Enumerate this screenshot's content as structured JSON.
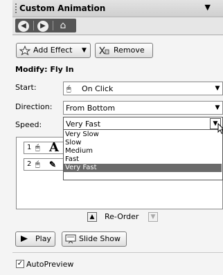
{
  "header": {
    "title": "Custom Animation",
    "menu_glyph": "▼",
    "nav": {
      "back_icon": "back-arrow-icon",
      "forward_icon": "forward-arrow-icon",
      "home_icon": "home-icon"
    }
  },
  "toolbar": {
    "add_effect_label": "Add Effect",
    "add_effect_arrow": "▼",
    "remove_label": "Remove"
  },
  "modify": {
    "heading": "Modify: Fly In",
    "start": {
      "label": "Start:",
      "value": "On Click"
    },
    "direction": {
      "label": "Direction:",
      "value": "From Bottom"
    },
    "speed": {
      "label": "Speed:",
      "value": "Very Fast",
      "options": [
        "Very Slow",
        "Slow",
        "Medium",
        "Fast",
        "Very Fast"
      ],
      "selected": "Very Fast"
    }
  },
  "effects_list": {
    "items": [
      {
        "number": "1",
        "glyph": "A"
      },
      {
        "number": "2",
        "glyph": "✎"
      }
    ]
  },
  "reorder": {
    "label": "Re-Order",
    "up_glyph": "▲",
    "down_glyph": "▼"
  },
  "buttons": {
    "play_label": "Play",
    "slideshow_label": "Slide Show"
  },
  "autopreview": {
    "label": "AutoPreview",
    "checked": true,
    "check_glyph": "✓"
  },
  "colors": {
    "selected_option_bg": "#6a6a6a",
    "pane_bg": "#f4f4f4"
  }
}
